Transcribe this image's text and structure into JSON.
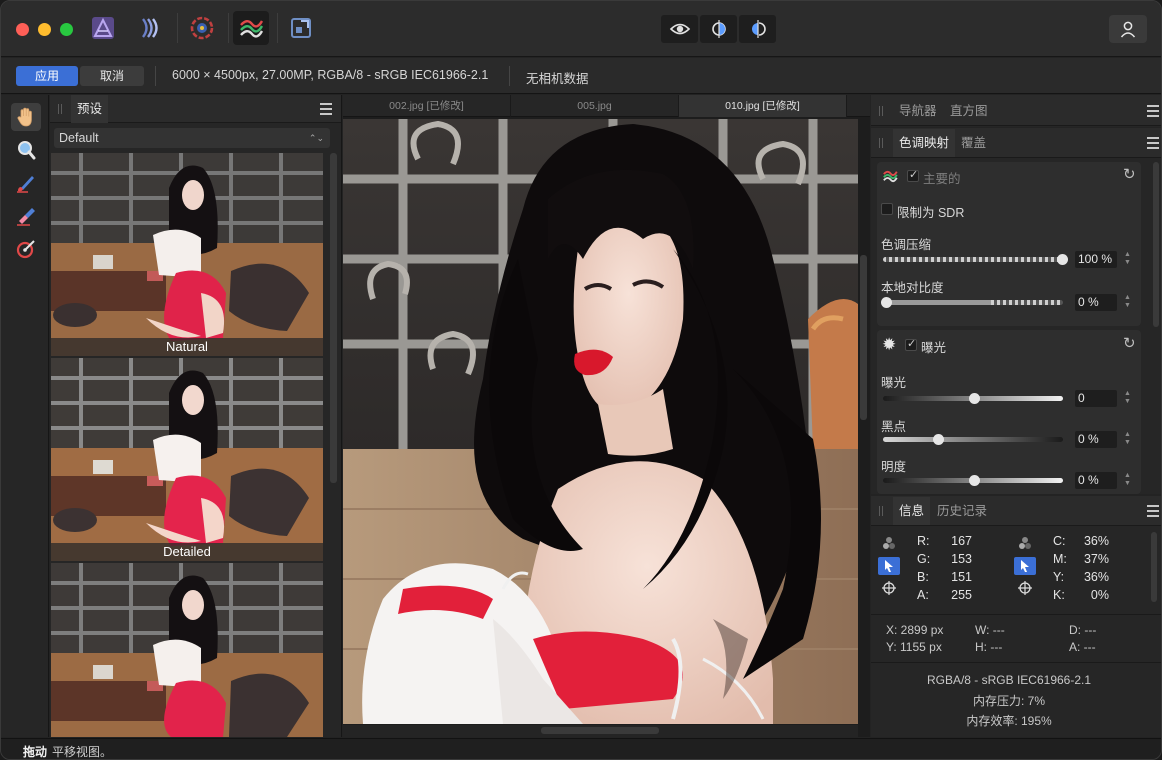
{
  "titlebar": {
    "personas": [
      "photo-persona",
      "liquify-persona",
      "develop-persona",
      "tone-mapping-persona",
      "export-persona"
    ],
    "active_persona": "tone-mapping-persona",
    "view_modes": [
      "single-view",
      "split-view",
      "mirror-view"
    ]
  },
  "context": {
    "apply": "应用",
    "cancel": "取消",
    "image_info": "6000 × 4500px, 27.00MP, RGBA/8 - sRGB IEC61966-2.1",
    "exif": "无相机数据"
  },
  "presets_panel": {
    "tab": "预设",
    "category": "Default",
    "items": [
      {
        "label": "Natural"
      },
      {
        "label": "Detailed"
      },
      {
        "label": ""
      }
    ]
  },
  "documents": {
    "tabs": [
      {
        "label": "002.jpg [已修改]",
        "active": false
      },
      {
        "label": "005.jpg",
        "active": false
      },
      {
        "label": "010.jpg [已修改]",
        "active": true
      }
    ]
  },
  "navigator_panel": {
    "tabs": [
      "导航器",
      "直方图"
    ]
  },
  "adjust_panel": {
    "tabs": [
      "色调映射",
      "覆盖"
    ],
    "tone_map": {
      "title": "主要的",
      "enabled": true,
      "limit_sdr_label": "限制为 SDR",
      "limit_sdr": false,
      "compression_label": "色调压缩",
      "compression_value": "100 %",
      "compression_fraction": 1.0,
      "local_contrast_label": "本地对比度",
      "local_contrast_value": "0 %",
      "local_contrast_fraction": 0.0
    },
    "exposure": {
      "title": "曝光",
      "enabled": true,
      "exposure_label": "曝光",
      "exposure_value": "0",
      "exposure_fraction": 0.5,
      "blackpoint_label": "黑点",
      "blackpoint_value": "0 %",
      "blackpoint_fraction": 0.3,
      "brightness_label": "明度",
      "brightness_value": "0 %",
      "brightness_fraction": 0.5
    }
  },
  "info_panel": {
    "tabs": [
      "信息",
      "历史记录"
    ],
    "rgba": [
      {
        "ch": "R:",
        "v": "167"
      },
      {
        "ch": "G:",
        "v": "153"
      },
      {
        "ch": "B:",
        "v": "151"
      },
      {
        "ch": "A:",
        "v": "255"
      }
    ],
    "cmyk": [
      {
        "ch": "C:",
        "v": "36%"
      },
      {
        "ch": "M:",
        "v": "37%"
      },
      {
        "ch": "Y:",
        "v": "36%"
      },
      {
        "ch": "K:",
        "v": "0%"
      }
    ],
    "x": "X: 2899 px",
    "y": "Y: 1155 px",
    "w": "W: ---",
    "h": "H: ---",
    "d": "D: ---",
    "a": "A: ---",
    "colorspace": "RGBA/8 - sRGB IEC61966-2.1",
    "mem_pressure": "内存压力: 7%",
    "mem_efficiency": "内存效率: 195%"
  },
  "status": {
    "bold": "拖动",
    "text": "平移视图。"
  },
  "colors": {
    "accent": "#3b6fd6",
    "apply": "#3b6fd6",
    "red": "#fe5f57",
    "yellow": "#febc2e",
    "green": "#28c840"
  }
}
